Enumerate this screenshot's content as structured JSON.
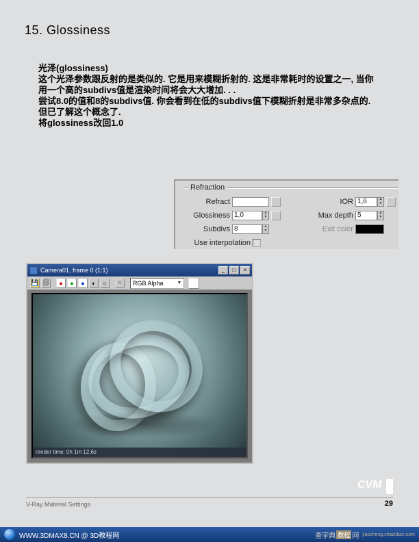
{
  "heading": "15. Glossiness",
  "body": {
    "l1": "光泽(glossiness)",
    "l2": "这个光泽参数跟反射的是类似的. 它是用来模糊折射的. 这是非常耗时的设置之一, 当你用一个高的subdivs值是渲染时间将会大大增加. . .",
    "l3": "尝试8.0的值和8的subdivs值. 你会看到在低的subdivs值下模糊折射是非常多杂点的. 但已了解这个概念了.",
    "l4": "将glossiness改回1.0"
  },
  "panel": {
    "title": "Refraction",
    "refract_label": "Refract",
    "glossiness_label": "Glossiness",
    "glossiness_val": "1,0",
    "subdivs_label": "Subdivs",
    "subdivs_val": "8",
    "interp_label": "Use interpolation",
    "ior_label": "IOR",
    "ior_val": "1,6",
    "maxdepth_label": "Max depth",
    "maxdepth_val": "5",
    "exitcolor_label": "Exit color",
    "refract_color": "#ffffff",
    "exit_color": "#000000"
  },
  "render": {
    "title": "Camera01, frame 0 (1:1)",
    "channel": "RGB Alpha",
    "status": "render time:  0h 1m 12,6s",
    "icons": {
      "save": "💾",
      "copy": "🗐",
      "rec": "●",
      "g": "●",
      "b": "●",
      "mono": "◐",
      "alpha": "○",
      "clear": "✕"
    },
    "winbtns": {
      "min": "_",
      "max": "□",
      "close": "×"
    }
  },
  "footer": {
    "left": "V-Ray Material Settings",
    "page": "29",
    "logo": "CVM"
  },
  "browser": {
    "url": "WWW.3DMAX8.CN @ 3D教程网",
    "wm1": "查字典",
    "wm2": "教程",
    "wm3": "网",
    "wm_sub": "jiaocheng.chazidian.com"
  }
}
